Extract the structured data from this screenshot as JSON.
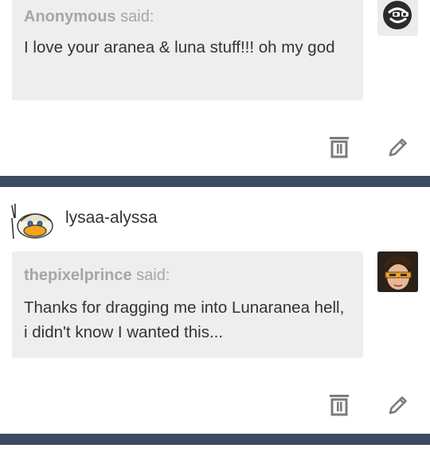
{
  "posts": [
    {
      "asker": {
        "name": "Anonymous",
        "said": "said:",
        "avatar_icon": "sunglasses-smiley-icon"
      },
      "question": "I love your aranea & luna stuff!!! oh my god",
      "actions": {
        "delete_icon": "trash-icon",
        "edit_icon": "pencil-icon"
      }
    },
    {
      "blog": {
        "name": "lysaa-alyssa",
        "avatar_icon": "duck-avatar-icon"
      },
      "asker": {
        "name": "thepixelprince",
        "said": "said:",
        "avatar_icon": "overwatch-tracer-avatar-icon"
      },
      "question": "Thanks for dragging me into Lunaranea hell, i didn't know I wanted this...",
      "actions": {
        "delete_icon": "trash-icon",
        "edit_icon": "pencil-icon"
      }
    }
  ],
  "colors": {
    "divider": "#3b4b60",
    "bubble": "#eeeeee",
    "muted": "#a6a6a6",
    "text": "#333333",
    "icon": "#7b7b7b"
  }
}
